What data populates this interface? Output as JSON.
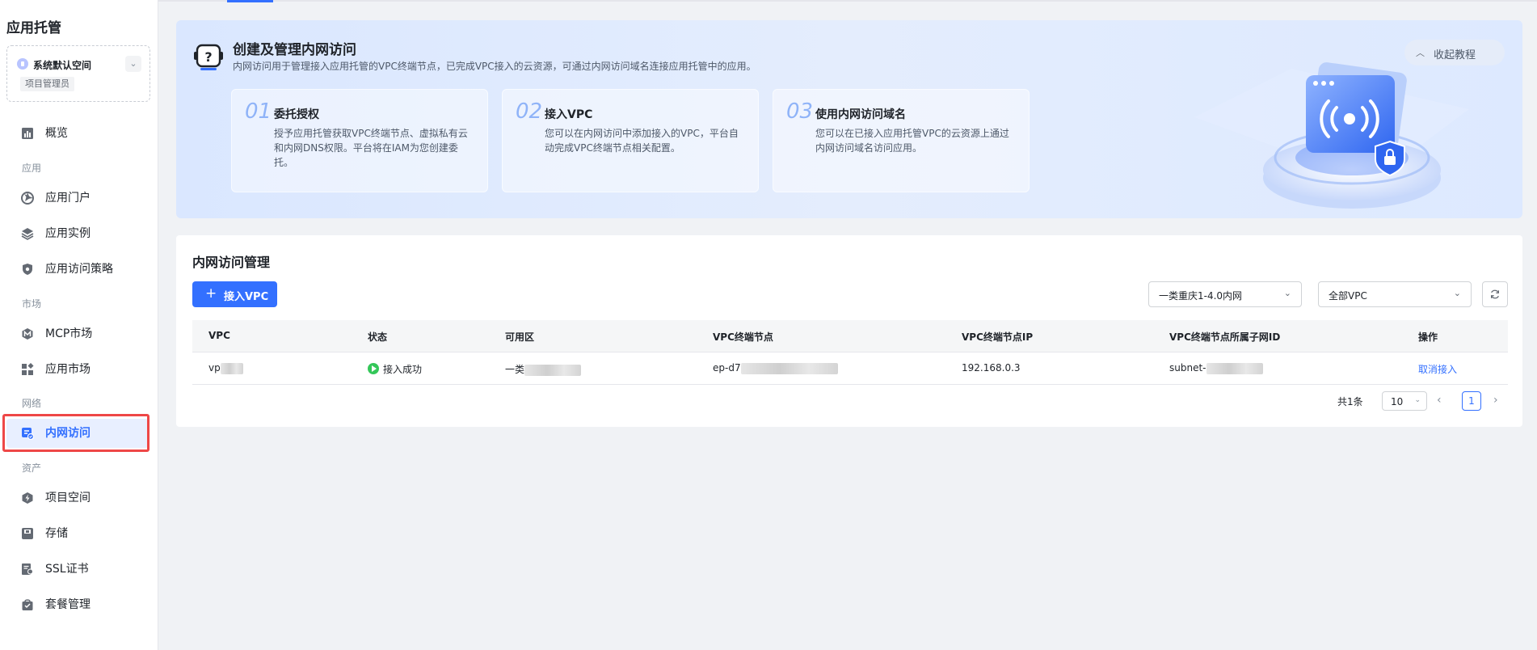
{
  "app": {
    "title": "应用托管"
  },
  "space": {
    "name": "系统默认空间",
    "role": "项目管理员"
  },
  "nav": {
    "overview": "概览",
    "group_app": "应用",
    "app_portal": "应用门户",
    "app_instance": "应用实例",
    "app_policy": "应用访问策略",
    "group_market": "市场",
    "mcp_market": "MCP市场",
    "app_market": "应用市场",
    "group_network": "网络",
    "intranet": "内网访问",
    "group_assets": "资产",
    "project_space": "项目空间",
    "storage": "存储",
    "ssl": "SSL证书",
    "package": "套餐管理"
  },
  "banner": {
    "title": "创建及管理内网访问",
    "desc": "内网访问用于管理接入应用托管的VPC终端节点，已完成VPC接入的云资源，可通过内网访问域名连接应用托管中的应用。",
    "collapse": "收起教程",
    "steps": [
      {
        "num": "01",
        "title": "委托授权",
        "desc": "授予应用托管获取VPC终端节点、虚拟私有云和内网DNS权限。平台将在IAM为您创建委托。"
      },
      {
        "num": "02",
        "title": "接入VPC",
        "desc": "您可以在内网访问中添加接入的VPC，平台自动完成VPC终端节点相关配置。"
      },
      {
        "num": "03",
        "title": "使用内网访问域名",
        "desc": "您可以在已接入应用托管VPC的云资源上通过内网访问域名访问应用。"
      }
    ]
  },
  "card": {
    "title": "内网访问管理",
    "add_button": "接入VPC",
    "region_select": "一类重庆1-4.0内网",
    "vpc_select": "全部VPC"
  },
  "table": {
    "headers": [
      "VPC",
      "状态",
      "可用区",
      "VPC终端节点",
      "VPC终端节点IP",
      "VPC终端节点所属子网ID",
      "操作"
    ],
    "rows": [
      {
        "vpc": "vp",
        "status": "接入成功",
        "zone": "一类",
        "endpoint": "ep-d7",
        "ip": "192.168.0.3",
        "subnet": "subnet-",
        "action": "取消接入"
      }
    ]
  },
  "pager": {
    "total": "共1条",
    "size": "10",
    "page": "1"
  },
  "colors": {
    "accent": "#3370ff",
    "success": "#34c759",
    "highlight": "#ee4747"
  }
}
